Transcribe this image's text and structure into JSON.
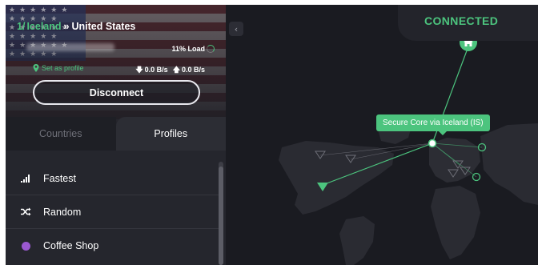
{
  "header": {
    "route_prefix": "1/",
    "route_via": "Iceland",
    "route_separator": "»",
    "route_destination": "United States",
    "load": "11% Load",
    "set_as_profile": "Set as profile",
    "download_speed": "0.0 B/s",
    "upload_speed": "0.0 B/s",
    "disconnect_label": "Disconnect"
  },
  "tabs": [
    {
      "label": "Countries",
      "active": false
    },
    {
      "label": "Profiles",
      "active": true
    }
  ],
  "profiles": [
    {
      "label": "Fastest",
      "icon": "signal-bars-icon"
    },
    {
      "label": "Random",
      "icon": "shuffle-icon"
    },
    {
      "label": "Coffee Shop",
      "icon": "profile-color-dot",
      "color": "#9b59d0"
    }
  ],
  "map": {
    "status": "CONNECTED",
    "tooltip": "Secure Core via Iceland (IS)",
    "collapse_icon": "chevron-left-icon",
    "home_icon": "home-icon"
  },
  "colors": {
    "accent": "#4cc47e",
    "background": "#1b1c22",
    "sidebar": "#25262d",
    "profile_dot": "#9b59d0"
  }
}
